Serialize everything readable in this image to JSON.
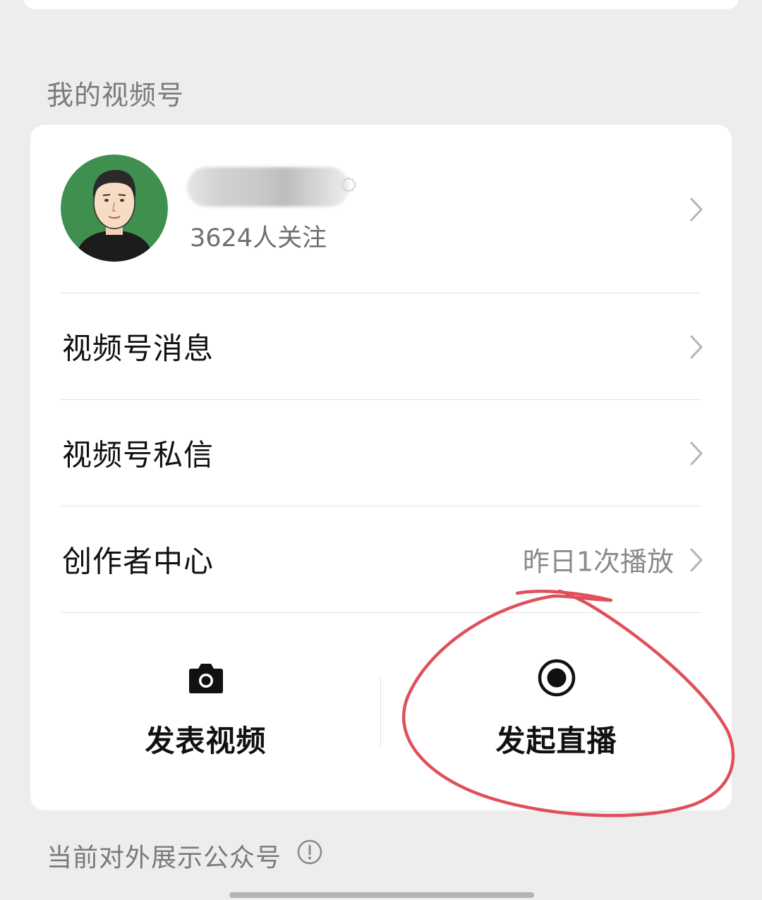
{
  "section_title": "我的视频号",
  "profile": {
    "followers_text": "3624人关注"
  },
  "menu": {
    "items": [
      {
        "label": "视频号消息",
        "value": ""
      },
      {
        "label": "视频号私信",
        "value": ""
      },
      {
        "label": "创作者中心",
        "value": "昨日1次播放"
      }
    ]
  },
  "actions": {
    "publish_video": {
      "label": "发表视频",
      "icon": "camera-icon"
    },
    "start_live": {
      "label": "发起直播",
      "icon": "record-icon"
    }
  },
  "footer": {
    "note": "当前对外展示公众号",
    "icon": "info-icon"
  },
  "colors": {
    "background": "#ededed",
    "card": "#ffffff",
    "annotation": "#e0505a",
    "avatar_bg": "#3f8f4f"
  }
}
